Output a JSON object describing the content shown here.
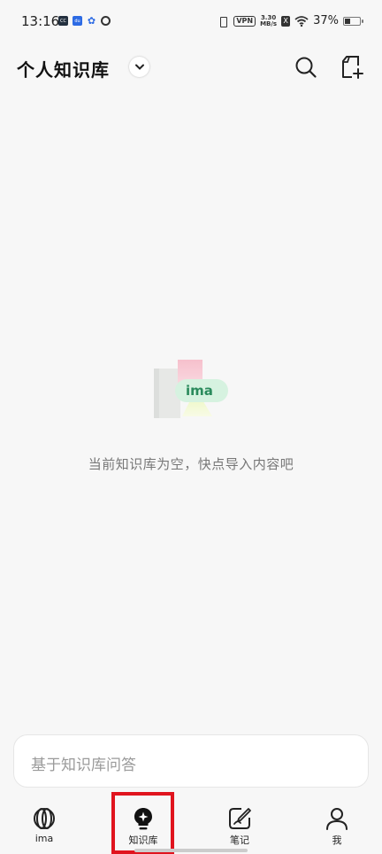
{
  "status_bar": {
    "time": "13:16",
    "app_icons": [
      "cc-icon",
      "baidu-icon",
      "paw-icon",
      "ring-icon"
    ],
    "vpn": "VPN",
    "speed_value": "3.30",
    "speed_unit": "MB/s",
    "x_badge": "X",
    "battery": "37%",
    "battery_level": 0.37
  },
  "header": {
    "title": "个人知识库"
  },
  "empty_state": {
    "logo_text": "ima",
    "message": "当前知识库为空，快点导入内容吧"
  },
  "ask": {
    "placeholder": "基于知识库问答"
  },
  "bottom_nav": {
    "items": [
      {
        "label": "ima",
        "icon": "ima-icon"
      },
      {
        "label": "知识库",
        "icon": "lightbulb-icon"
      },
      {
        "label": "笔记",
        "icon": "note-pen-icon"
      },
      {
        "label": "我",
        "icon": "person-icon"
      }
    ],
    "active_index": 1
  },
  "colors": {
    "background": "#f7f7f7",
    "highlight": "#e0141e",
    "accent_green": "#2a8a5c"
  }
}
